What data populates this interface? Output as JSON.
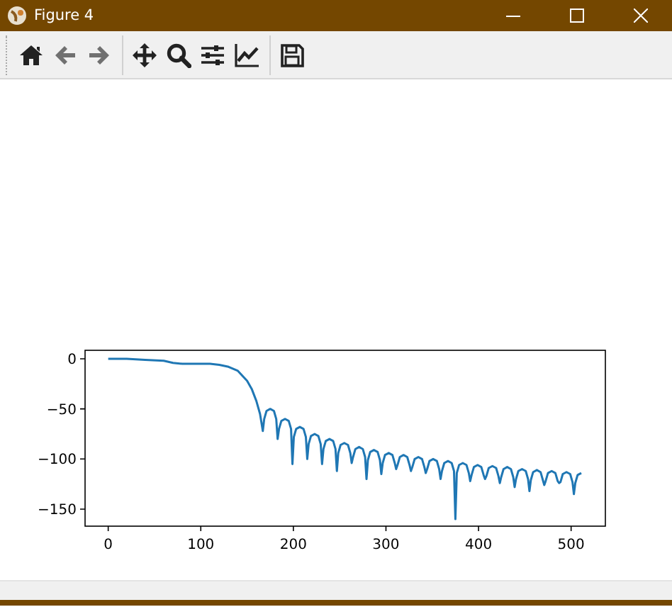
{
  "window": {
    "title": "Figure 4"
  },
  "toolbar": [
    {
      "kind": "home",
      "disabled": false
    },
    {
      "kind": "back",
      "disabled": true
    },
    {
      "kind": "forward",
      "disabled": true
    },
    {
      "kind": "separator"
    },
    {
      "kind": "pan",
      "disabled": false
    },
    {
      "kind": "zoom",
      "disabled": false
    },
    {
      "kind": "subplots",
      "disabled": false
    },
    {
      "kind": "axes",
      "disabled": false
    },
    {
      "kind": "separator"
    },
    {
      "kind": "save",
      "disabled": false
    }
  ],
  "figure": {
    "chart_data": {
      "type": "line",
      "xlim": [
        -25,
        537
      ],
      "ylim": [
        -167,
        8.5
      ],
      "xticks": [
        0,
        100,
        200,
        300,
        400,
        500
      ],
      "yticks": [
        {
          "value": 0,
          "label": "0"
        },
        {
          "value": -50,
          "label": "−50"
        },
        {
          "value": -100,
          "label": "−100"
        },
        {
          "value": -150,
          "label": "−150"
        }
      ],
      "x": [
        0,
        20,
        40,
        60,
        70,
        80,
        90,
        100,
        110,
        120,
        130,
        140,
        150,
        155,
        160,
        164,
        167,
        168.5,
        171,
        175,
        179,
        181.5,
        183,
        184.5,
        187,
        191,
        195,
        197.5,
        199,
        200.5,
        203,
        207,
        211,
        213.5,
        215,
        216.5,
        219,
        223,
        227,
        229.5,
        231,
        232.5,
        235,
        239,
        243,
        245.5,
        247,
        248.5,
        251,
        255,
        259,
        261.5,
        263,
        264.5,
        267,
        271,
        275,
        277.5,
        279,
        280.5,
        283,
        287,
        291,
        293.5,
        295,
        296.5,
        299,
        303,
        307,
        309.5,
        311,
        312.5,
        315,
        319,
        323,
        325.5,
        327,
        328.5,
        331,
        335,
        339,
        341.5,
        343,
        344.5,
        347,
        351,
        355,
        357.5,
        359,
        360.5,
        363,
        367,
        371,
        373.5,
        375,
        376.5,
        379,
        383,
        387,
        389.5,
        391,
        392.5,
        395,
        399,
        403,
        405.5,
        407,
        408.5,
        411,
        415,
        419,
        421.5,
        423,
        424.5,
        427,
        431,
        435,
        437.5,
        439,
        440.5,
        443,
        447,
        451,
        453.5,
        455,
        456.5,
        459,
        463,
        467,
        469.5,
        471,
        472.5,
        475,
        479,
        483,
        485.5,
        487,
        488.5,
        491,
        495,
        499,
        501.5,
        503,
        504.5,
        507,
        511
      ],
      "series": [
        {
          "color": "#1f77b4",
          "values": [
            0,
            0,
            -1,
            -2,
            -4,
            -5,
            -5,
            -5,
            -5,
            -6,
            -8,
            -12,
            -22,
            -30,
            -42,
            -55,
            -72,
            -60,
            -52,
            -50,
            -52,
            -60,
            -80,
            -70,
            -62,
            -60,
            -62,
            -70,
            -105,
            -78,
            -70,
            -68,
            -70,
            -78,
            -100,
            -85,
            -77,
            -75,
            -77,
            -85,
            -105,
            -90,
            -82,
            -80,
            -82,
            -90,
            -112,
            -94,
            -86,
            -84,
            -86,
            -94,
            -104,
            -98,
            -90,
            -88,
            -90,
            -98,
            -120,
            -101,
            -93,
            -91,
            -93,
            -101,
            -115,
            -104,
            -96,
            -94,
            -96,
            -104,
            -110,
            -106,
            -98,
            -96,
            -98,
            -106,
            -112,
            -108,
            -100,
            -98,
            -100,
            -108,
            -114,
            -110,
            -102,
            -100,
            -102,
            -110,
            -120,
            -112,
            -104,
            -102,
            -104,
            -112,
            -160,
            -114,
            -106,
            -104,
            -106,
            -114,
            -122,
            -116,
            -108,
            -106,
            -108,
            -116,
            -120,
            -117,
            -109,
            -107,
            -109,
            -117,
            -124,
            -118,
            -110,
            -108,
            -110,
            -118,
            -128,
            -120,
            -112,
            -110,
            -112,
            -120,
            -132,
            -121,
            -113,
            -111,
            -113,
            -121,
            -126,
            -122,
            -114,
            -112,
            -114,
            -122,
            -124,
            -123,
            -115,
            -113,
            -115,
            -123,
            -135,
            -124,
            -116,
            -114
          ]
        }
      ]
    }
  }
}
